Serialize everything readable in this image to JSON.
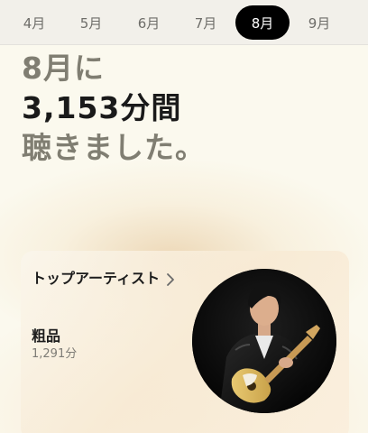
{
  "months": [
    {
      "label": "4月",
      "active": false
    },
    {
      "label": "5月",
      "active": false
    },
    {
      "label": "6月",
      "active": false
    },
    {
      "label": "7月",
      "active": false
    },
    {
      "label": "8月",
      "active": true
    },
    {
      "label": "9月",
      "active": false
    }
  ],
  "headline": {
    "line1": "8月に",
    "line2": "3,153分間",
    "line3": "聴きました。"
  },
  "top_artist_card": {
    "title": "トップアーティスト",
    "artist_name": "粗品",
    "artist_minutes": "1,291分",
    "photo_icon": "artist-photo-guitarist"
  },
  "colors": {
    "active_tab_bg": "#000000",
    "headline_muted": "#807e72",
    "headline_strong": "#1a1a1a"
  }
}
